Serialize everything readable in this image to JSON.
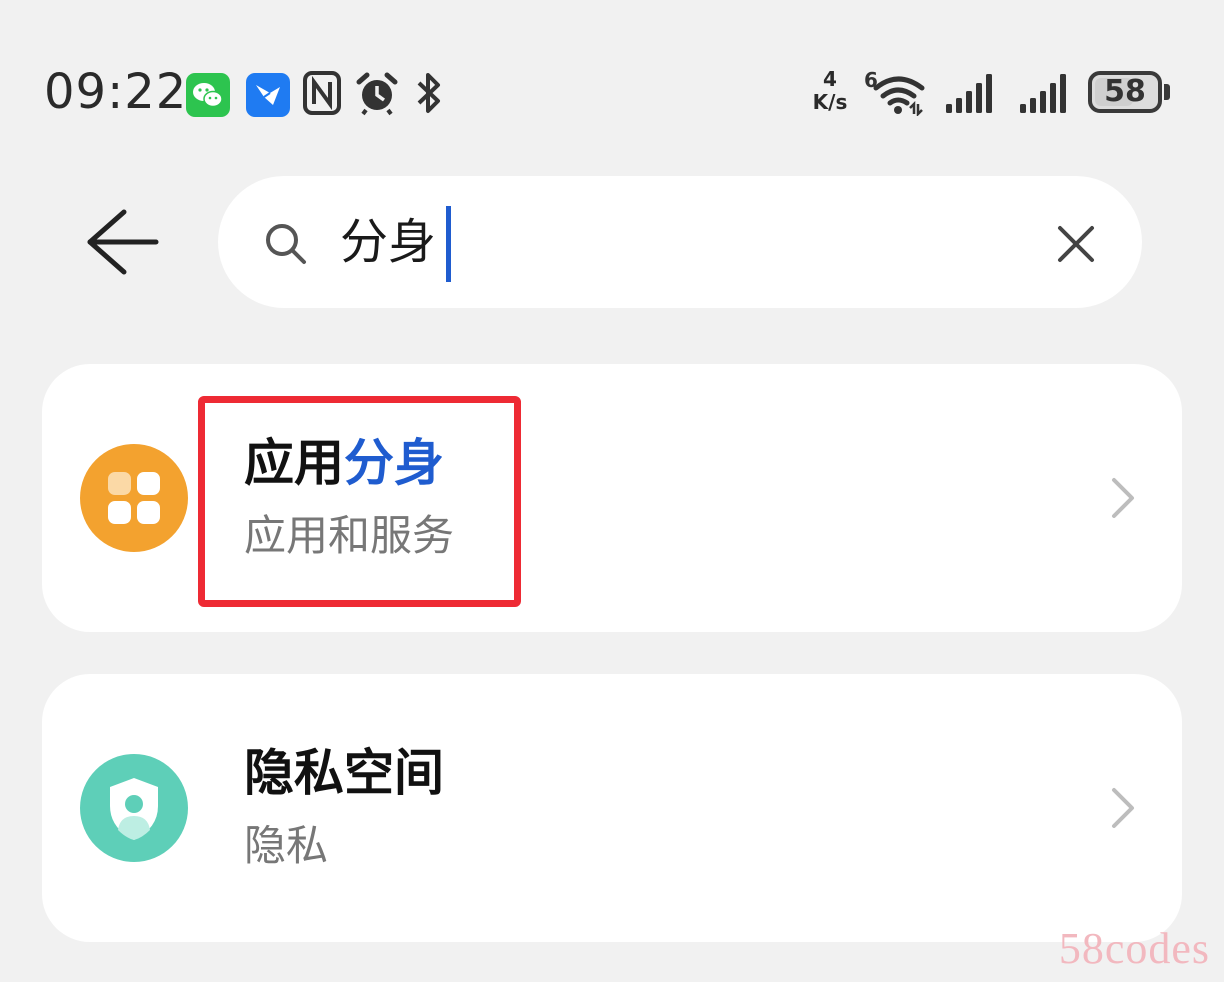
{
  "status_bar": {
    "time": "09:22",
    "net_speed_value": "4",
    "net_speed_unit": "K/s",
    "wifi_badge": "6",
    "battery_level": "58",
    "icons": [
      "wechat-icon",
      "feishu-icon",
      "nfc-icon",
      "alarm-icon",
      "bluetooth-icon",
      "wifi-icon",
      "signal-icon",
      "signal-icon",
      "battery-icon"
    ]
  },
  "search": {
    "query": "分身"
  },
  "results": [
    {
      "title_prefix": "应用",
      "title_highlight": "分身",
      "subtitle": "应用和服务",
      "icon": "app-grid-icon",
      "icon_color": "#f3a22f"
    },
    {
      "title": "隐私空间",
      "subtitle": "隐私",
      "icon": "privacy-shield-icon",
      "icon_color": "#5ecfb8"
    }
  ],
  "colors": {
    "highlight": "#1f5ccf",
    "annotation_box": "#ee2a34",
    "background": "#f1f1f1"
  },
  "watermark": "58codes"
}
